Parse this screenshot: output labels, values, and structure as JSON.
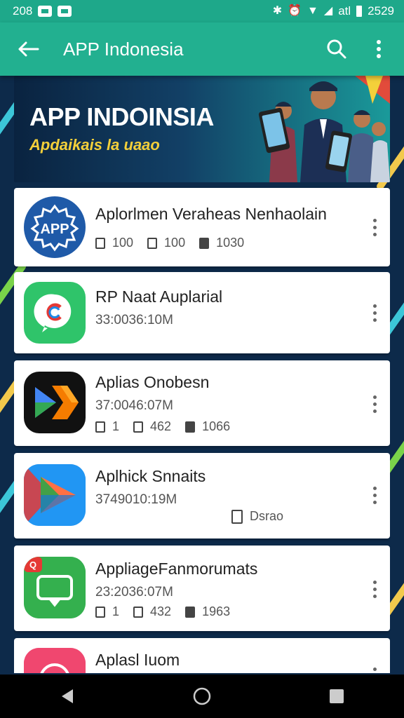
{
  "status_bar": {
    "time_left": "208",
    "time_right": "2529",
    "carrier_text": "atl"
  },
  "app_bar": {
    "title": "APP Indonesia",
    "back_icon": "arrow-left-icon",
    "search_icon": "search-icon",
    "menu_icon": "more-vert-icon"
  },
  "banner": {
    "title": "APP INDOINSIA",
    "subtitle": "Apdaikais la uaao"
  },
  "apps": [
    {
      "name": "Aplorlmen Verahеas Nenhaolain",
      "icon_label": "APP",
      "stats": [
        "100",
        "100",
        "1030"
      ]
    },
    {
      "name": "RP Naat Auplarial",
      "meta": "33:0036:10M"
    },
    {
      "name": "Aplias Onobesn",
      "meta": "37:0046:07M",
      "stats": [
        "1",
        "462",
        "1066"
      ]
    },
    {
      "name": "Aplhick Snnaits",
      "meta": "3749010:19M",
      "extra": "Dsrao"
    },
    {
      "name": "AppliageFanmorumats",
      "meta": "23:2036:07M",
      "stats": [
        "1",
        "432",
        "1963"
      ],
      "badge": "Q"
    },
    {
      "name": "Aplasl Iuom"
    }
  ],
  "colors": {
    "status_bar": "#1ea88a",
    "app_bar": "#22b090",
    "background": "#0d2a4a",
    "banner_subtitle": "#f4d03a"
  }
}
